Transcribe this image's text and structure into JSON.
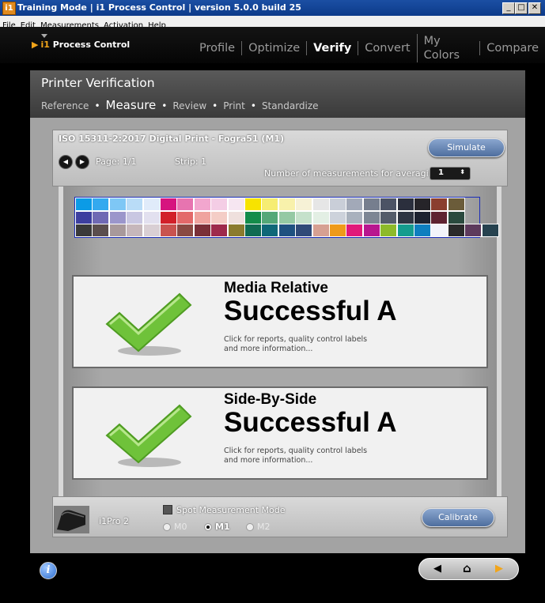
{
  "window": {
    "title": "Training Mode | i1 Process Control | version 5.0.0 build 25",
    "icon_text": "i1",
    "controls": {
      "minimize": "_",
      "maximize": "□",
      "close": "✕"
    }
  },
  "menubar": [
    "File",
    "Edit",
    "Measurements",
    "Activation",
    "Help"
  ],
  "app": {
    "brand_prefix": "i1",
    "brand_name": "Process Control",
    "nav_tabs": [
      "Profile",
      "Optimize",
      "Verify",
      "Convert",
      "My Colors",
      "Compare"
    ],
    "active_tab": "Verify"
  },
  "panel": {
    "title": "Printer Verification",
    "steps": [
      "Reference",
      "Measure",
      "Review",
      "Print",
      "Standardize"
    ],
    "active_step": "Measure",
    "standard_title": "ISO 15311-2:2017 Digital Print - Fogra51 (M1)",
    "page_label": "Page: 1/1",
    "strip_label": "Strip: 1",
    "averaging_label": "Number of measurements for averaging",
    "averaging_value": "1",
    "simulate_label": "Simulate"
  },
  "patch_colors": [
    [
      "#0b9be6",
      "#34a9ef",
      "#7ec7f5",
      "#b9dcf7",
      "#e0ebfa",
      "#d6147f",
      "#e774b0",
      "#f2a6ce",
      "#f4cde5",
      "#f6e6f1",
      "#f7e300",
      "#f6ed72",
      "#f8f1ab",
      "#f6f1d6",
      "#e6e6e6",
      "#c9ced8",
      "#a2a9b8",
      "#767e8e",
      "#4c5365",
      "#2b2f3d",
      "#262429",
      "#8a3e2f",
      "#6b5c3a"
    ],
    [
      "#3d3f9f",
      "#6f69b4",
      "#9b96cb",
      "#c9c7e2",
      "#e2e0ef",
      "#d22029",
      "#e3696a",
      "#efa39e",
      "#f4cdc6",
      "#efe0dd",
      "#138c4a",
      "#54a878",
      "#95c9a4",
      "#c5e1cb",
      "#e3efe4",
      "#cdd2db",
      "#a9b1bd",
      "#7d8694",
      "#545c6a",
      "#2e3542",
      "#1d2230",
      "#5e2331",
      "#2a4a3e"
    ],
    [
      "#3a3a3a",
      "#5a4e4e",
      "#a8999b",
      "#c6b7bb",
      "#d9cfd4",
      "#c9534f",
      "#8a4a43",
      "#7a2f38",
      "#9e2a4c",
      "#8b7b2e",
      "#106b52",
      "#0f6878",
      "#1e5180",
      "#2f4a78",
      "#d6a092",
      "#ef9a1a",
      "#e1197a",
      "#b8168f",
      "#8dba2a",
      "#159c8e",
      "#0e7fbf",
      "#f2f4fa",
      "#2a2a2a",
      "#5d3a5c",
      "#26424f"
    ]
  ],
  "results": [
    {
      "subtitle": "Media Relative",
      "status": "Successful A",
      "note_line1": "Click for reports, quality control labels",
      "note_line2": "and more information..."
    },
    {
      "subtitle": "Side-By-Side",
      "status": "Successful A",
      "note_line1": "Click for reports, quality control labels",
      "note_line2": "and more information..."
    }
  ],
  "device": {
    "name": "i1Pro 2",
    "spot_label": "Spot Measurement Mode",
    "modes": [
      "M0",
      "M1",
      "M2"
    ],
    "selected_mode": "M1",
    "calibrate_label": "Calibrate"
  },
  "footer": {
    "info_icon": "i",
    "nav": {
      "back": "◀",
      "home": "⌂",
      "next": "▶"
    }
  },
  "colors": {
    "accent_orange": "#f2a51a",
    "button_blue": "#5b7bab",
    "check_green": "#6fc23a"
  }
}
